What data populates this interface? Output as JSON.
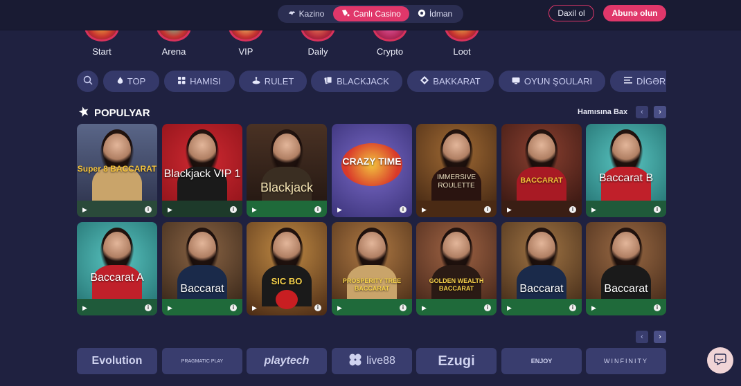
{
  "topbar": {
    "tabs": [
      {
        "label": "Kazino",
        "icon": "kazino-icon"
      },
      {
        "label": "Canlı Casino",
        "icon": "live-casino-icon"
      },
      {
        "label": "İdman",
        "icon": "soccer-ball-icon"
      }
    ],
    "login_label": "Daxil ol",
    "signup_label": "Abunə olun"
  },
  "promos": [
    {
      "label": "Start"
    },
    {
      "label": "Arena"
    },
    {
      "label": "VIP"
    },
    {
      "label": "Daily"
    },
    {
      "label": "Crypto"
    },
    {
      "label": "Loot"
    }
  ],
  "filters": [
    {
      "label": "TOP",
      "icon": "flame-icon"
    },
    {
      "label": "HAMISI",
      "icon": "grid-icon"
    },
    {
      "label": "RULET",
      "icon": "roulette-icon"
    },
    {
      "label": "BLACKJACK",
      "icon": "cards-icon"
    },
    {
      "label": "BAKKARAT",
      "icon": "diamond-icon"
    },
    {
      "label": "OYUN ŞOULARI",
      "icon": "tv-show-icon"
    },
    {
      "label": "DİGƏR",
      "icon": "list-icon"
    }
  ],
  "section": {
    "title": "POPULYAR",
    "see_all": "Hamısına Bax"
  },
  "games_row1": [
    {
      "title": "Super 8 BACCARAT",
      "bg": "#4a5576"
    },
    {
      "title": "Blackjack VIP 1",
      "bg": "#b01b22"
    },
    {
      "title": "Blackjack",
      "bg": "#3a2a22"
    },
    {
      "title": "CRAZY TIME",
      "bg": "#5a4c9c"
    },
    {
      "title": "IMMERSIVE ROULETTE",
      "bg": "#6a3a1e"
    },
    {
      "title": "BACCARAT",
      "bg": "#5a2a22"
    },
    {
      "title": "Baccarat B",
      "bg": "#3a8a8c"
    }
  ],
  "games_row2": [
    {
      "title": "Baccarat A",
      "bg": "#3a9a9c"
    },
    {
      "title": "Baccarat",
      "bg": "#5a3a26"
    },
    {
      "title": "SIC BO",
      "bg": "#7a4a24"
    },
    {
      "title": "PROSPERITY TREE BACCARAT",
      "bg": "#6a4a26"
    },
    {
      "title": "GOLDEN WEALTH BACCARAT",
      "bg": "#6a4030"
    },
    {
      "title": "Baccarat",
      "bg": "#5a3e28"
    },
    {
      "title": "Baccarat",
      "bg": "#5a3a2a"
    }
  ],
  "providers": [
    {
      "label": "Evolution"
    },
    {
      "label": "PRAGMATIC PLAY"
    },
    {
      "label": "playtech"
    },
    {
      "label": "live88"
    },
    {
      "label": "Ezugi"
    },
    {
      "label": "ENJOY"
    },
    {
      "label": "WINFINITY"
    }
  ],
  "info_glyph": "i"
}
